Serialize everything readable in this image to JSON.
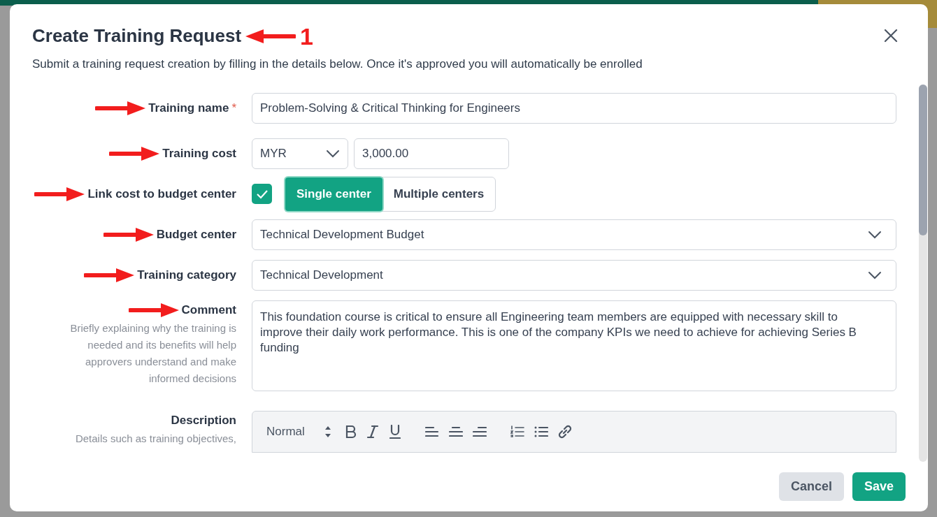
{
  "dialog": {
    "title": "Create Training Request",
    "subtitle": "Submit a training request creation by filling in the details below. Once it's approved you will automatically be enrolled"
  },
  "title_annotation": {
    "label": "1"
  },
  "fields": [
    {
      "kind": "text",
      "label": "Training name",
      "required_mark": "*",
      "annotated": true,
      "value": "Problem-Solving & Critical Thinking for Engineers"
    },
    {
      "kind": "cost",
      "label": "Training cost",
      "annotated": true,
      "currency": "MYR",
      "value": "3,000.00"
    },
    {
      "kind": "toggle",
      "label": "Link cost to budget center",
      "annotated": true,
      "checked": true,
      "options": [
        {
          "label": "Single center",
          "selected": true
        },
        {
          "label": "Multiple centers",
          "selected": false
        }
      ]
    },
    {
      "kind": "select",
      "label": "Budget center",
      "annotated": true,
      "value": "Technical Development Budget"
    },
    {
      "kind": "select",
      "label": "Training category",
      "annotated": true,
      "value": "Technical Development"
    },
    {
      "kind": "textarea",
      "label": "Comment",
      "annotated": true,
      "help": "Briefly explaining why the training is needed and its benefits will help approvers understand and make informed decisions",
      "value": "This foundation course is critical to ensure all Engineering team members are equipped with necessary skill to improve their daily work performance. This is one of the company KPIs we need to achieve for achieving Series B funding"
    },
    {
      "kind": "editor",
      "label": "Description",
      "help": "Details such as training objectives,",
      "format": "Normal"
    }
  ],
  "buttons": [
    {
      "label": "Cancel",
      "kind": "secondary"
    },
    {
      "label": "Save",
      "kind": "primary"
    }
  ]
}
